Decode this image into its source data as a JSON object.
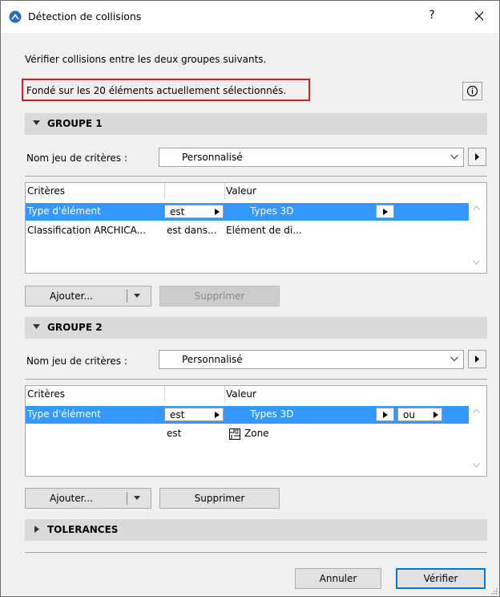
{
  "window": {
    "title": "Détection de collisions",
    "help_label": "?"
  },
  "intro_text": "Vérifier collisions entre les deux groupes suivants.",
  "selection_note": "Fondé sur les 20 éléments actuellement sélectionnés.",
  "group1": {
    "title": "GROUPE 1",
    "criteria_set_label": "Nom jeu de critères :",
    "criteria_set_value": "Personnalisé",
    "columns": [
      "Critères",
      "Valeur"
    ],
    "rows": [
      {
        "criterion": "Type d'élément",
        "operator": "est",
        "value": "Types 3D"
      },
      {
        "criterion": "Classification ARCHICA...",
        "operator": "est dans...",
        "value": "Elément de di..."
      }
    ],
    "add_label": "Ajouter...",
    "delete_label": "Supprimer"
  },
  "group2": {
    "title": "GROUPE 2",
    "criteria_set_label": "Nom jeu de critères :",
    "criteria_set_value": "Personnalisé",
    "columns": [
      "Critères",
      "Valeur"
    ],
    "rows": [
      {
        "criterion": "Type d'élément",
        "operator": "est",
        "value": "Types 3D",
        "logic": "ou"
      },
      {
        "criterion": "",
        "operator": "est",
        "value": "Zone"
      }
    ],
    "add_label": "Ajouter...",
    "delete_label": "Supprimer"
  },
  "tolerances_title": "TOLERANCES",
  "footer": {
    "cancel_label": "Annuler",
    "verify_label": "Vérifier"
  },
  "colors": {
    "selection": "#3399ff",
    "highlight_border": "#e01818",
    "primary_border": "#0078d7"
  }
}
